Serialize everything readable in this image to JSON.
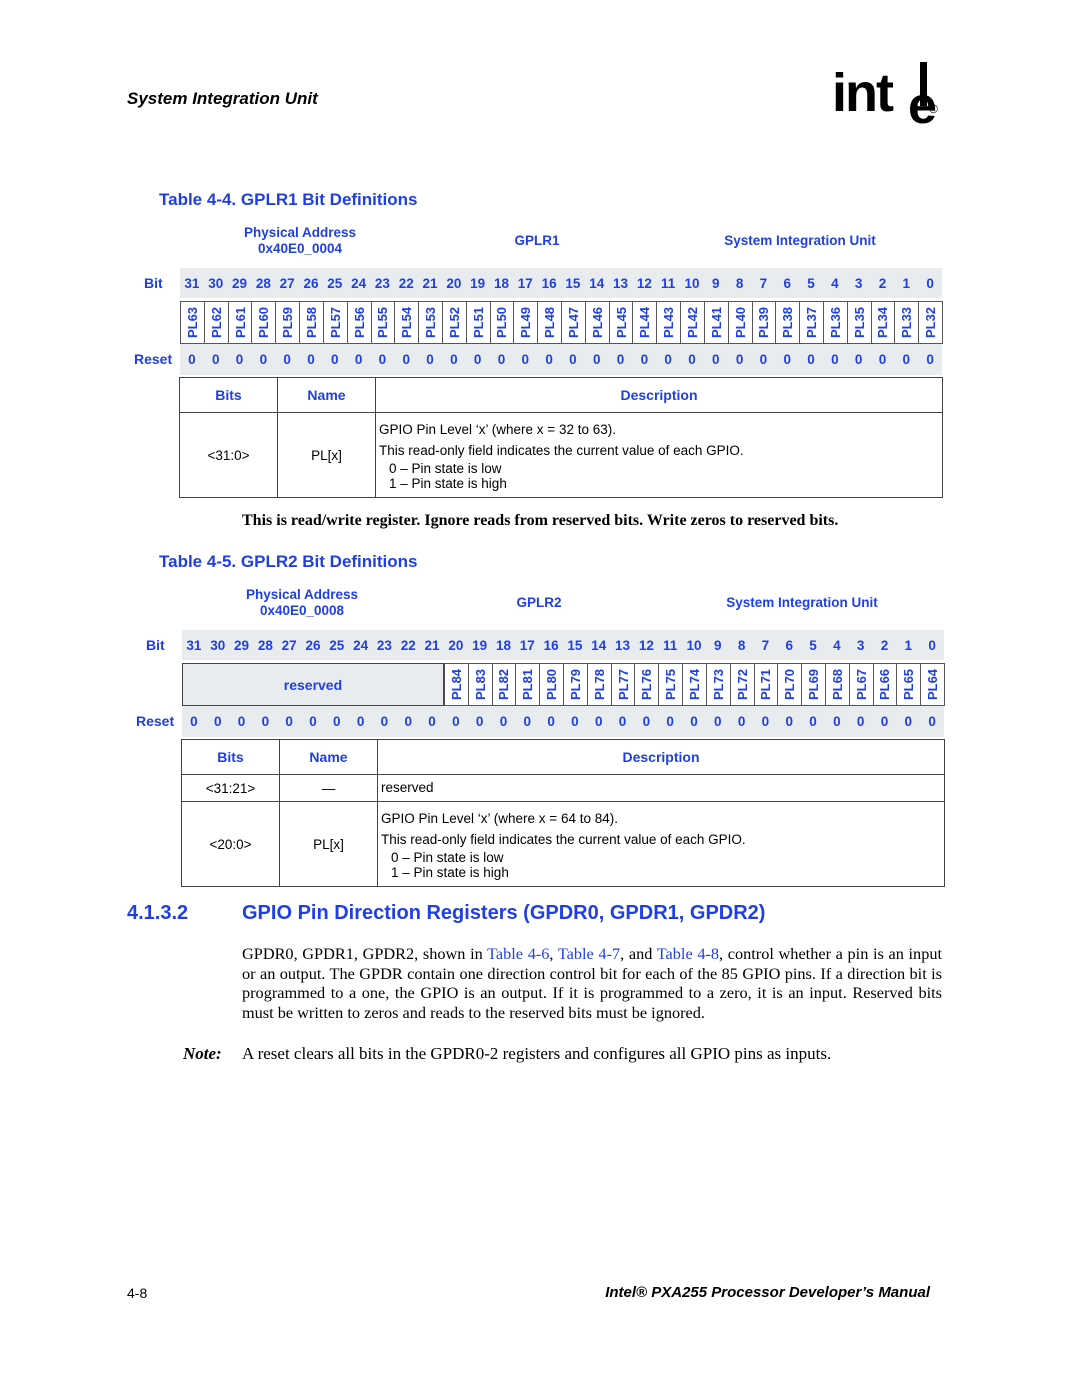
{
  "header": {
    "section": "System Integration Unit",
    "logo": "intel"
  },
  "table1": {
    "title": "Table 4-4. GPLR1 Bit Definitions",
    "addr_label": "Physical Address",
    "addr": "0x40E0_0004",
    "reg": "GPLR1",
    "unit": "System Integration Unit",
    "bit_label": "Bit",
    "reset_label": "Reset",
    "bits": [
      "31",
      "30",
      "29",
      "28",
      "27",
      "26",
      "25",
      "24",
      "23",
      "22",
      "21",
      "20",
      "19",
      "18",
      "17",
      "16",
      "15",
      "14",
      "13",
      "12",
      "11",
      "10",
      "9",
      "8",
      "7",
      "6",
      "5",
      "4",
      "3",
      "2",
      "1",
      "0"
    ],
    "fields": [
      "PL63",
      "PL62",
      "PL61",
      "PL60",
      "PL59",
      "PL58",
      "PL57",
      "PL56",
      "PL55",
      "PL54",
      "PL53",
      "PL52",
      "PL51",
      "PL50",
      "PL49",
      "PL48",
      "PL47",
      "PL46",
      "PL45",
      "PL44",
      "PL43",
      "PL42",
      "PL41",
      "PL40",
      "PL39",
      "PL38",
      "PL37",
      "PL36",
      "PL35",
      "PL34",
      "PL33",
      "PL32"
    ],
    "reset": [
      "0",
      "0",
      "0",
      "0",
      "0",
      "0",
      "0",
      "0",
      "0",
      "0",
      "0",
      "0",
      "0",
      "0",
      "0",
      "0",
      "0",
      "0",
      "0",
      "0",
      "0",
      "0",
      "0",
      "0",
      "0",
      "0",
      "0",
      "0",
      "0",
      "0",
      "0",
      "0"
    ],
    "cols": {
      "bits": "Bits",
      "name": "Name",
      "desc": "Description"
    },
    "rows": [
      {
        "bits": "<31:0>",
        "name": "PL[x]",
        "lines": [
          "GPIO Pin Level ‘x’ (where x = 32 to 63).",
          "This read-only field indicates the current value of each GPIO.",
          "0 –  Pin state is low",
          "1 –  Pin state is high"
        ]
      }
    ]
  },
  "note_rw": "This is read/write register. Ignore reads from reserved bits. Write zeros to reserved bits.",
  "table2": {
    "title": "Table 4-5. GPLR2 Bit Definitions",
    "addr_label": "Physical Address",
    "addr": "0x40E0_0008",
    "reg": "GPLR2",
    "unit": "System Integration Unit",
    "bit_label": "Bit",
    "reset_label": "Reset",
    "bits": [
      "31",
      "30",
      "29",
      "28",
      "27",
      "26",
      "25",
      "24",
      "23",
      "22",
      "21",
      "20",
      "19",
      "18",
      "17",
      "16",
      "15",
      "14",
      "13",
      "12",
      "11",
      "10",
      "9",
      "8",
      "7",
      "6",
      "5",
      "4",
      "3",
      "2",
      "1",
      "0"
    ],
    "reserved_label": "reserved",
    "fields": [
      "PL84",
      "PL83",
      "PL82",
      "PL81",
      "PL80",
      "PL79",
      "PL78",
      "PL77",
      "PL76",
      "PL75",
      "PL74",
      "PL73",
      "PL72",
      "PL71",
      "PL70",
      "PL69",
      "PL68",
      "PL67",
      "PL66",
      "PL65",
      "PL64"
    ],
    "reset": [
      "0",
      "0",
      "0",
      "0",
      "0",
      "0",
      "0",
      "0",
      "0",
      "0",
      "0",
      "0",
      "0",
      "0",
      "0",
      "0",
      "0",
      "0",
      "0",
      "0",
      "0",
      "0",
      "0",
      "0",
      "0",
      "0",
      "0",
      "0",
      "0",
      "0",
      "0",
      "0"
    ],
    "cols": {
      "bits": "Bits",
      "name": "Name",
      "desc": "Description"
    },
    "rows": [
      {
        "bits": "<31:21>",
        "name": "—",
        "lines": [
          "reserved"
        ]
      },
      {
        "bits": "<20:0>",
        "name": "PL[x]",
        "lines": [
          "GPIO Pin Level ‘x’ (where x = 64 to 84).",
          "This read-only field indicates the current value of each GPIO.",
          "0 –  Pin state is low",
          "1 –  Pin state is high"
        ]
      }
    ]
  },
  "section": {
    "number": "4.1.3.2",
    "title": "GPIO Pin Direction Registers (GPDR0, GPDR1, GPDR2)",
    "p_a": "GPDR0, GPDR1, GPDR2, shown in ",
    "link1": "Table 4-6",
    "p_b": ", ",
    "link2": "Table 4-7",
    "p_c": ", and ",
    "link3": "Table 4-8",
    "p_d": ", control whether a pin is an input or an output. The GPDR contain one direction control bit for each of the 85 GPIO pins. If a direction bit is programmed to a one, the GPIO is an output. If it is programmed to a zero, it is an input. Reserved bits must be written to zeros and reads to the reserved bits must be ignored.",
    "note_label": "Note:",
    "note_text": "A reset clears all bits in the GPDR0-2 registers and configures all GPIO pins as inputs."
  },
  "footer": {
    "page": "4-8",
    "manual": "Intel® PXA255 Processor Developer’s Manual"
  },
  "colors": {
    "accent": "#1f3fe6",
    "band": "#e9ecee"
  }
}
